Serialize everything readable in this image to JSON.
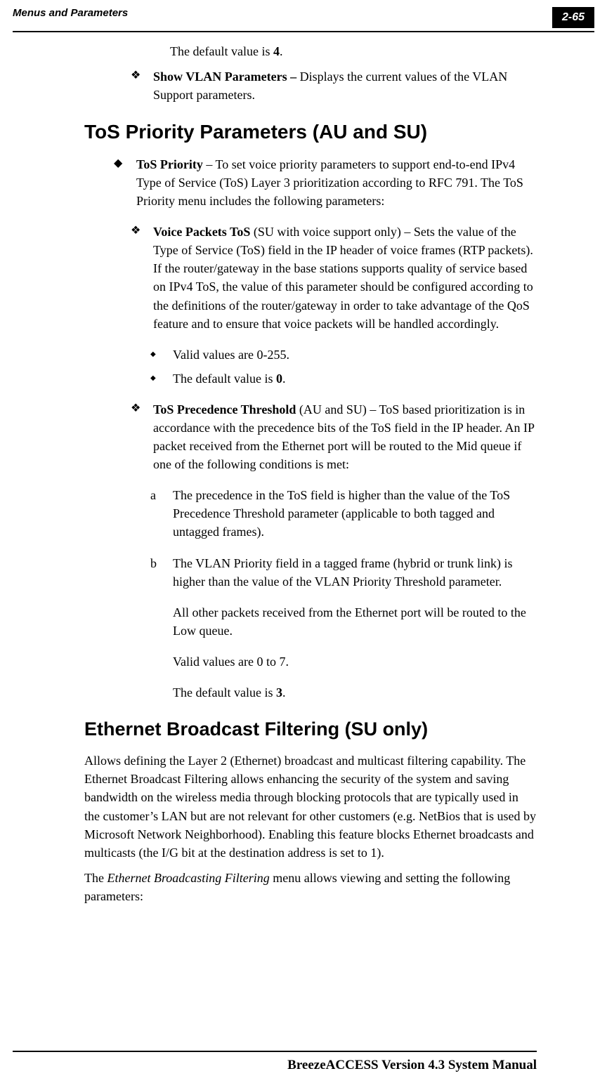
{
  "header": {
    "section": "Menus and Parameters",
    "page": "2-65"
  },
  "p1_pre": "The default value is ",
  "p1_bold": "4",
  "p1_post": ".",
  "show_vlan_bold": "Show VLAN Parameters – ",
  "show_vlan_text": "Displays the current values of the VLAN Support parameters.",
  "heading_tos": "ToS Priority Parameters (AU and SU)",
  "tos_priority_bold": "ToS Priority",
  "tos_priority_text": " – To set voice priority parameters to support end-to-end IPv4 Type of Service (ToS) Layer 3 prioritization according to RFC 791. The ToS Priority menu includes the following parameters:",
  "voice_packets_bold": "Voice Packets ToS",
  "voice_packets_text": " (SU with voice support only) – Sets the value of the Type of Service (ToS) field in the IP header of voice frames (RTP packets). If the router/gateway in the base stations supports quality of service based on IPv4 ToS, the value of this parameter should be configured according to the definitions of the router/gateway in order to take advantage of the QoS feature and to ensure that voice packets will be handled accordingly.",
  "vp_valid": "Valid values are 0-255.",
  "vp_default_pre": "The default value is ",
  "vp_default_bold": "0",
  "vp_default_post": ".",
  "tos_prec_bold": "ToS Precedence Threshold",
  "tos_prec_text": " (AU and SU) – ToS based prioritization is in accordance with the precedence bits of the ToS field in the IP header. An IP packet received from the Ethernet port will be routed to the Mid queue if one of the following conditions is met:",
  "alpha_a_label": "a",
  "alpha_a_text": "The precedence in the ToS field is higher than the value of the ToS Precedence Threshold parameter (applicable to both tagged and untagged frames).",
  "alpha_b_label": "b",
  "alpha_b_text": "The VLAN Priority field in a tagged frame (hybrid or trunk link) is higher than the value of the VLAN Priority Threshold parameter.",
  "all_other": "All other packets received from the Ethernet port will be routed to the Low queue.",
  "valid_07": "Valid values are 0 to 7.",
  "default3_pre": "The default value is ",
  "default3_bold": "3",
  "default3_post": ".",
  "heading_eth": "Ethernet Broadcast Filtering (SU only)",
  "eth_para": "Allows defining the Layer 2 (Ethernet) broadcast and multicast filtering capability. The Ethernet Broadcast Filtering allows enhancing the security of the system and saving bandwidth on the wireless media through blocking protocols that are typically used in the customer’s LAN but are not relevant for other customers (e.g. NetBios that is used by Microsoft Network Neighborhood). Enabling this feature blocks Ethernet broadcasts and multicasts (the I/G bit at the destination address is set to 1).",
  "eth_para2_pre": "The ",
  "eth_para2_italic": "Ethernet Broadcasting Filtering",
  "eth_para2_post": " menu allows viewing and setting the following parameters:",
  "footer": "BreezeACCESS Version 4.3 System Manual"
}
